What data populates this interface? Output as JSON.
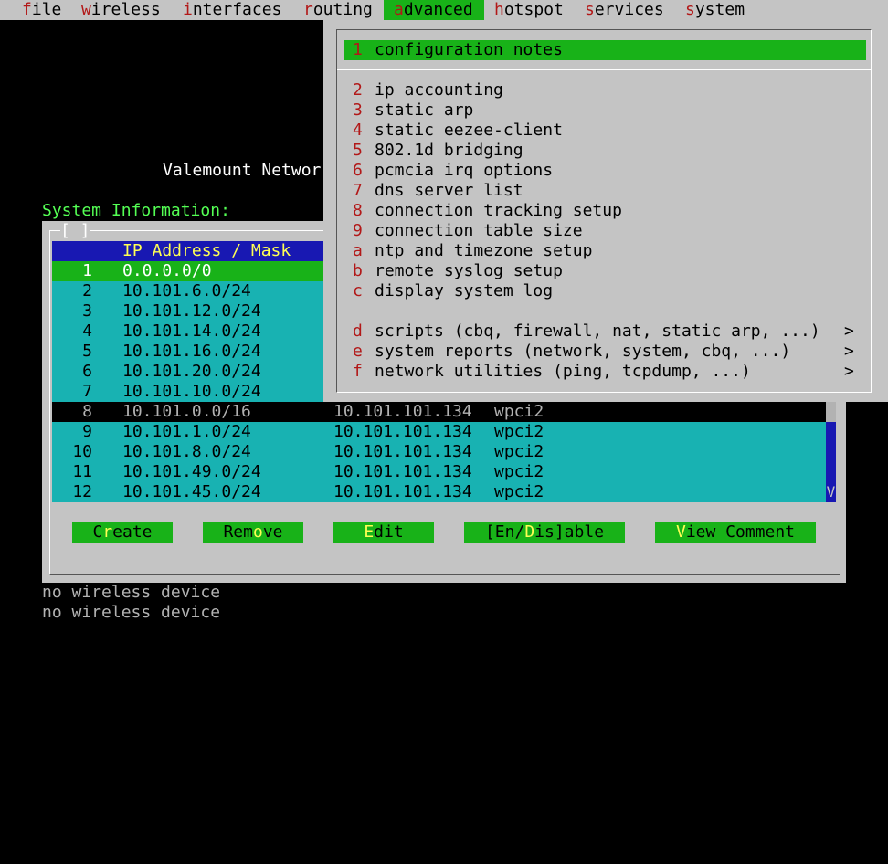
{
  "menubar": {
    "items": [
      {
        "hotkey": "f",
        "rest": "ile"
      },
      {
        "hotkey": "w",
        "rest": "ireless"
      },
      {
        "hotkey": "i",
        "rest": "nterfaces"
      },
      {
        "hotkey": "r",
        "rest": "outing"
      },
      {
        "hotkey": "a",
        "rest": "dvanced"
      },
      {
        "hotkey": "h",
        "rest": "otspot"
      },
      {
        "hotkey": "s",
        "rest": "ervices"
      },
      {
        "hotkey": "s",
        "rest": "ystem"
      }
    ]
  },
  "background": {
    "title_fragment": "Valemount Networ",
    "system_info_label": "System Information:",
    "footer_lines": [
      "no wireless device",
      "no wireless device"
    ]
  },
  "dialog": {
    "title": "[ ]",
    "header": {
      "col1": "IP Address / Mask"
    },
    "rows": [
      {
        "num": "1",
        "ip": "0.0.0.0/0",
        "gw": "",
        "iface": ""
      },
      {
        "num": "2",
        "ip": "10.101.6.0/24",
        "gw": "",
        "iface": ""
      },
      {
        "num": "3",
        "ip": "10.101.12.0/24",
        "gw": "",
        "iface": ""
      },
      {
        "num": "4",
        "ip": "10.101.14.0/24",
        "gw": "",
        "iface": ""
      },
      {
        "num": "5",
        "ip": "10.101.16.0/24",
        "gw": "",
        "iface": ""
      },
      {
        "num": "6",
        "ip": "10.101.20.0/24",
        "gw": "",
        "iface": ""
      },
      {
        "num": "7",
        "ip": "10.101.10.0/24",
        "gw": "",
        "iface": ""
      },
      {
        "num": "8",
        "ip": "10.101.0.0/16",
        "gw": "10.101.101.134",
        "iface": "wpci2"
      },
      {
        "num": "9",
        "ip": "10.101.1.0/24",
        "gw": "10.101.101.134",
        "iface": "wpci2"
      },
      {
        "num": "10",
        "ip": "10.101.8.0/24",
        "gw": "10.101.101.134",
        "iface": "wpci2"
      },
      {
        "num": "11",
        "ip": "10.101.49.0/24",
        "gw": "10.101.101.134",
        "iface": "wpci2"
      },
      {
        "num": "12",
        "ip": "10.101.45.0/24",
        "gw": "10.101.101.134",
        "iface": "wpci2"
      }
    ],
    "scroll_glyph": "V",
    "buttons": [
      {
        "pre": "C",
        "hk": "r",
        "post": "eate"
      },
      {
        "pre": "Rem",
        "hk": "o",
        "post": "ve"
      },
      {
        "pre": "",
        "hk": "E",
        "post": "dit"
      },
      {
        "pre": "[En/",
        "hk": "D",
        "post": "is]able"
      },
      {
        "pre": "",
        "hk": "V",
        "post": "iew Comment"
      }
    ]
  },
  "dropdown": {
    "items": [
      {
        "num": "1",
        "label": "configuration notes",
        "arrow": ""
      },
      {
        "num": "2",
        "label": "ip accounting",
        "arrow": ""
      },
      {
        "num": "3",
        "label": "static arp",
        "arrow": ""
      },
      {
        "num": "4",
        "label": "static eezee-client",
        "arrow": ""
      },
      {
        "num": "5",
        "label": "802.1d bridging",
        "arrow": ""
      },
      {
        "num": "6",
        "label": "pcmcia irq options",
        "arrow": ""
      },
      {
        "num": "7",
        "label": "dns server list",
        "arrow": ""
      },
      {
        "num": "8",
        "label": "connection tracking setup",
        "arrow": ""
      },
      {
        "num": "9",
        "label": "connection table size",
        "arrow": ""
      },
      {
        "num": "a",
        "label": "ntp and timezone setup",
        "arrow": ""
      },
      {
        "num": "b",
        "label": "remote syslog setup",
        "arrow": ""
      },
      {
        "num": "c",
        "label": "display system log",
        "arrow": ""
      },
      {
        "num": "d",
        "label": "scripts (cbq, firewall, nat, static arp, ...)",
        "arrow": ">"
      },
      {
        "num": "e",
        "label": "system reports (network, system, cbq, ...)",
        "arrow": ">"
      },
      {
        "num": "f",
        "label": "network utilities (ping, tcpdump, ...)",
        "arrow": ">"
      }
    ]
  }
}
